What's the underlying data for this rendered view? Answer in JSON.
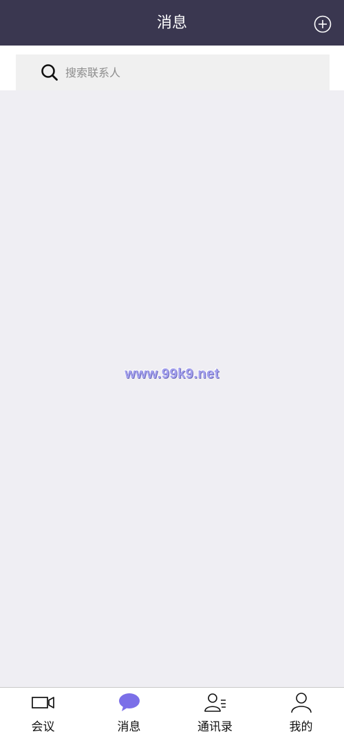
{
  "header": {
    "title": "消息"
  },
  "search": {
    "placeholder": "搜索联系人"
  },
  "watermark": {
    "text": "www.99k9.net"
  },
  "tabbar": {
    "active_color": "#7b6fe8",
    "tabs": [
      {
        "label": "会议",
        "icon": "video-camera-icon"
      },
      {
        "label": "消息",
        "icon": "chat-bubble-icon",
        "active": true
      },
      {
        "label": "通讯录",
        "icon": "contacts-icon"
      },
      {
        "label": "我的",
        "icon": "person-icon"
      }
    ]
  }
}
